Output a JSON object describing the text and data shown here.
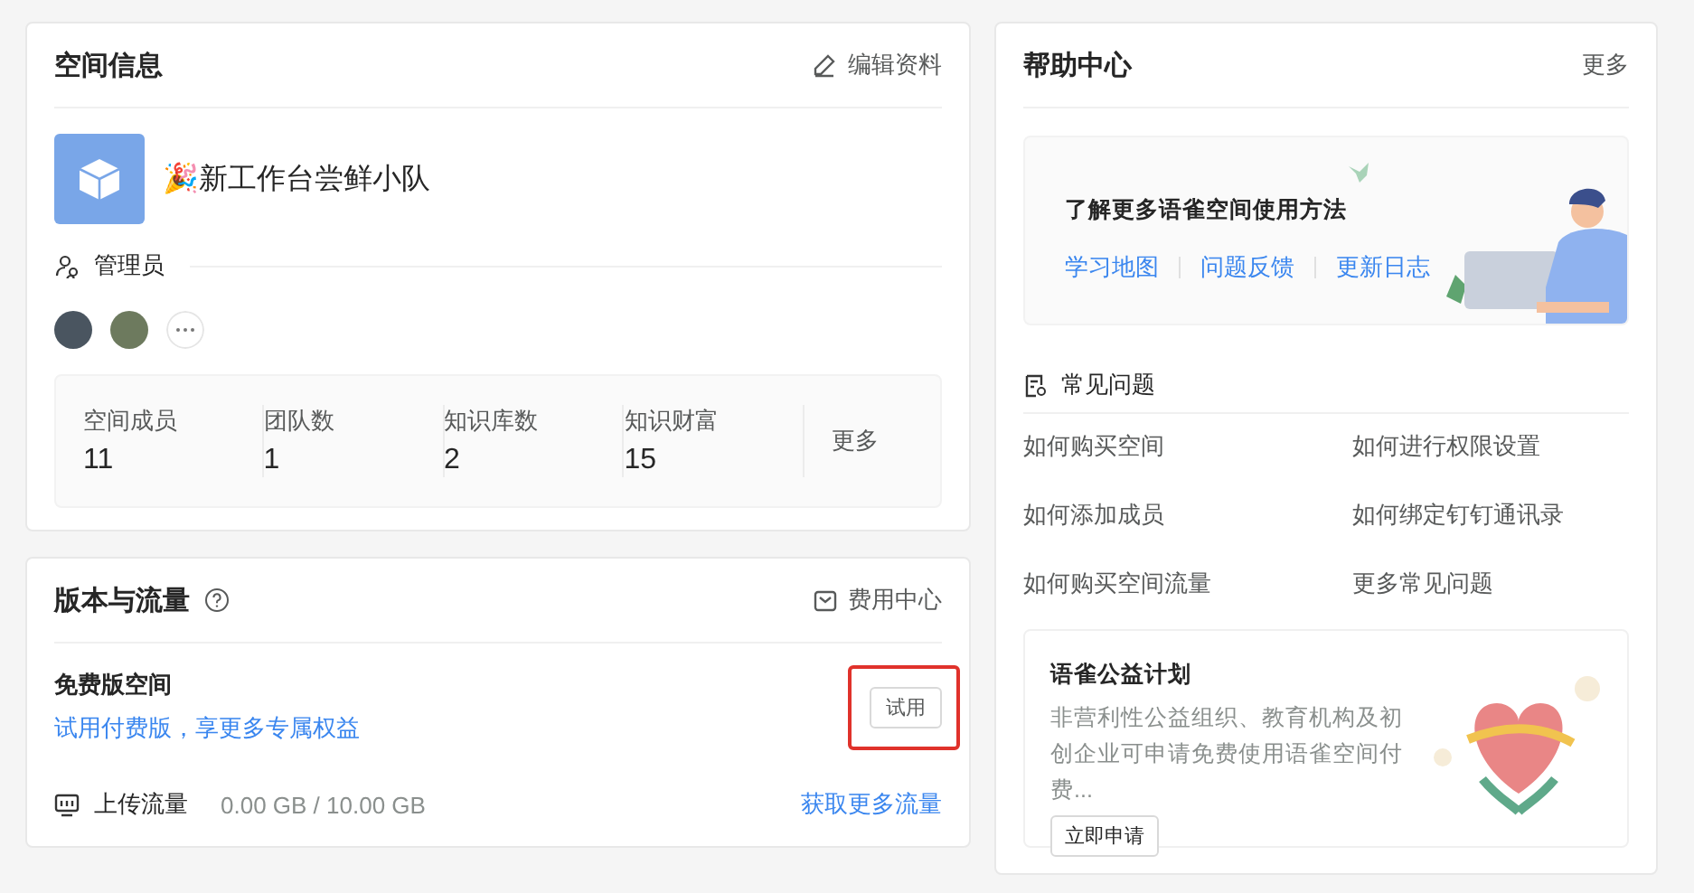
{
  "space_info": {
    "title": "空间信息",
    "edit": "编辑资料",
    "name": "🎉新工作台尝鲜小队",
    "admin_label": "管理员",
    "stats": [
      {
        "label": "空间成员",
        "value": "11"
      },
      {
        "label": "团队数",
        "value": "1"
      },
      {
        "label": "知识库数",
        "value": "2"
      },
      {
        "label": "知识财富",
        "value": "15"
      }
    ],
    "stats_more": "更多"
  },
  "plan": {
    "title": "版本与流量",
    "billing": "费用中心",
    "plan_name": "免费版空间",
    "upgrade_link": "试用付费版，享更多专属权益",
    "trial_button": {
      "label": "试用",
      "highlighted": true
    },
    "upload_label": "上传流量",
    "upload_usage": "0.00 GB / 10.00 GB",
    "more_traffic": "获取更多流量"
  },
  "help": {
    "title": "帮助中心",
    "more": "更多",
    "banner": {
      "title": "了解更多语雀空间使用方法",
      "links": [
        "学习地图",
        "问题反馈",
        "更新日志"
      ]
    },
    "faq_title": "常见问题",
    "faq": [
      "如何购买空间",
      "如何进行权限设置",
      "如何添加成员",
      "如何绑定钉钉通讯录",
      "如何购买空间流量",
      "更多常见问题"
    ],
    "charity": {
      "title": "语雀公益计划",
      "text": "非营利性公益组织、教育机构及初创企业可申请免费使用语雀空间付费...",
      "button": "立即申请"
    }
  }
}
